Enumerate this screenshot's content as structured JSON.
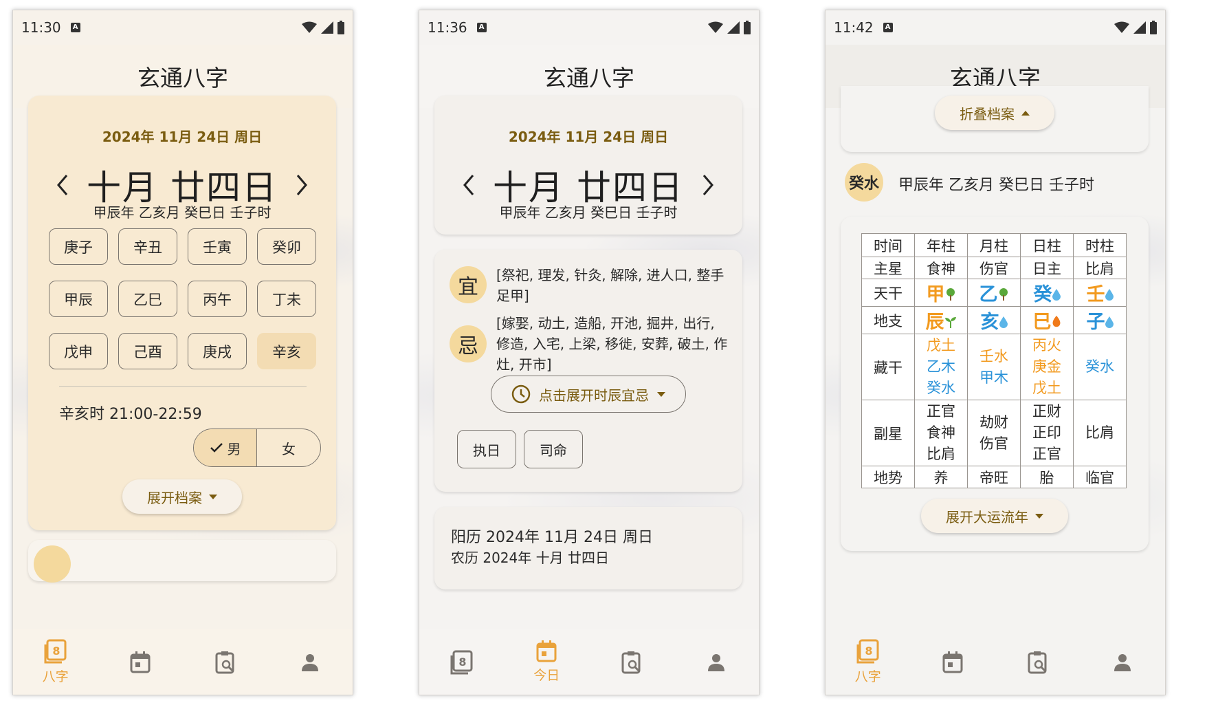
{
  "screens": [
    {
      "time": "11:30",
      "title": "玄通八字",
      "date": "2024年 11月 24日 周日",
      "lunar": "十月 廿四日",
      "ganzhi": "甲辰年 乙亥月 癸巳日 壬子时",
      "hours": [
        "庚子",
        "辛丑",
        "壬寅",
        "癸卯",
        "甲辰",
        "乙巳",
        "丙午",
        "丁未",
        "戊申",
        "己酉",
        "庚戌",
        "辛亥"
      ],
      "selected_hour": "辛亥",
      "selected_hour_text": "辛亥时 21:00-22:59",
      "gender_male": "男",
      "gender_female": "女",
      "selected_gender": "男",
      "expand_archive": "展开档案",
      "active_tab": "八字"
    },
    {
      "time": "11:36",
      "title": "玄通八字",
      "date": "2024年 11月 24日 周日",
      "lunar": "十月 廿四日",
      "ganzhi": "甲辰年 乙亥月 癸巳日 壬子时",
      "yi_label": "宜",
      "yi_text": "[祭祀, 理发, 针灸, 解除, 进人口, 整手足甲]",
      "ji_label": "忌",
      "ji_text": "[嫁娶, 动土, 造船, 开池, 掘井, 出行, 修造, 入宅, 上梁, 移徙, 安葬, 破土, 作灶, 开市]",
      "expand_hour_yiji": "点击展开时辰宜忌",
      "officer_button": "执日",
      "star_button": "司命",
      "solar_line": "阳历 2024年 11月 24日 周日",
      "lunar_line": "农历 2024年 十月 廿四日",
      "active_tab": "今日"
    },
    {
      "time": "11:42",
      "title": "玄通八字",
      "collapse_archive": "折叠档案",
      "day_master": "癸水",
      "ganzhi": "甲辰年 乙亥月 癸巳日 壬子时",
      "expand_dayun": "展开大运流年",
      "active_tab": "八字",
      "table": {
        "headers": [
          "时间",
          "年柱",
          "月柱",
          "日柱",
          "时柱"
        ],
        "main_star": [
          "主星",
          "食神",
          "伤官",
          "日主",
          "比肩"
        ],
        "tiangan_label": "天干",
        "tiangan": [
          {
            "char": "甲",
            "element": "wood",
            "icon": "tree-icon"
          },
          {
            "char": "乙",
            "element": "wood",
            "icon": "tree-icon"
          },
          {
            "char": "癸",
            "element": "water",
            "icon": "water-drop-icon"
          },
          {
            "char": "壬",
            "element": "water",
            "icon": "water-drop-icon"
          }
        ],
        "dizhi_label": "地支",
        "dizhi": [
          {
            "char": "辰",
            "element": "earth",
            "icon": "sprout-icon"
          },
          {
            "char": "亥",
            "element": "water",
            "icon": "water-drop-icon"
          },
          {
            "char": "巳",
            "element": "fire",
            "icon": "flame-icon"
          },
          {
            "char": "子",
            "element": "water",
            "icon": "water-drop-icon"
          }
        ],
        "canggan_label": "藏干",
        "canggan": [
          [
            "戊土",
            "乙木",
            "癸水"
          ],
          [
            "壬水",
            "甲木"
          ],
          [
            "丙火",
            "庚金",
            "戊土"
          ],
          [
            "癸水"
          ]
        ],
        "fuxing_label": "副星",
        "fuxing": [
          [
            "正官",
            "食神",
            "比肩"
          ],
          [
            "劫财",
            "伤官"
          ],
          [
            "正财",
            "正印",
            "正官"
          ],
          [
            "比肩"
          ]
        ],
        "dishi_label": "地势",
        "dishi": [
          "养",
          "帝旺",
          "胎",
          "临官"
        ]
      }
    }
  ],
  "nav": [
    "八字",
    "今日"
  ],
  "colors": {
    "accent": "#e9a23b",
    "brown_text": "#7a5c10",
    "chip_selected": "#f3dcb3",
    "badge": "#f4d99d",
    "wood": "#e8a020",
    "water": "#2a92d8"
  }
}
